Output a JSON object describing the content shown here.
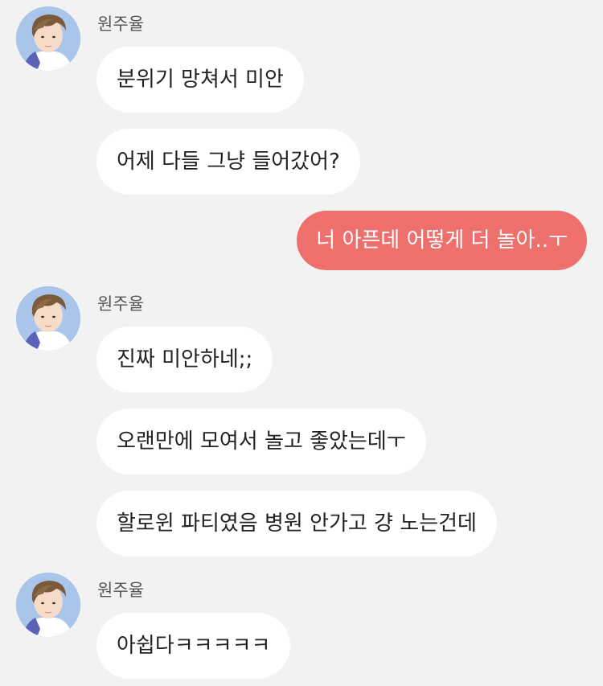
{
  "colors": {
    "background": "#f2f2f2",
    "incoming_bubble": "#ffffff",
    "outgoing_bubble": "#ee706d",
    "outgoing_text": "#ffffff",
    "name_text": "#555555"
  },
  "contact": {
    "name": "원주율",
    "avatar_icon": "profile-avatar"
  },
  "messages": [
    {
      "direction": "incoming",
      "text": "분위기 망쳐서 미안"
    },
    {
      "direction": "incoming",
      "text": "어제 다들 그냥 들어갔어?"
    },
    {
      "direction": "outgoing",
      "text": "너 아픈데 어떻게 더 놀아..ㅜ"
    },
    {
      "direction": "incoming",
      "text": "진짜 미안하네;;"
    },
    {
      "direction": "incoming",
      "text": "오랜만에 모여서 놀고 좋았는데ㅜ"
    },
    {
      "direction": "incoming",
      "text": "할로윈 파티였음 병원 안가고 걍 노는건데"
    },
    {
      "direction": "incoming",
      "text": "아쉽다ㅋㅋㅋㅋㅋ"
    }
  ]
}
